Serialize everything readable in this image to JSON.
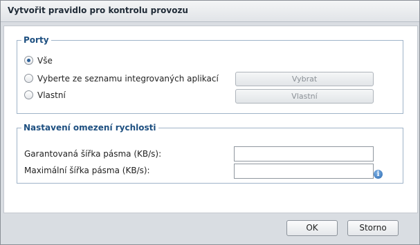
{
  "dialog": {
    "title": "Vytvořit pravidlo pro kontrolu provozu"
  },
  "ports": {
    "legend": "Porty",
    "options": [
      {
        "label": "Vše",
        "checked": true
      },
      {
        "label": "Vyberte ze seznamu integrovaných aplikací",
        "checked": false
      },
      {
        "label": "Vlastní",
        "checked": false
      }
    ],
    "select_button": "Vybrat",
    "custom_button": "Vlastní"
  },
  "speed": {
    "legend": "Nastavení omezení rychlosti",
    "guaranteed_label": "Garantovaná šířka pásma (KB/s):",
    "guaranteed_value": "",
    "max_label": "Maximální šířka pásma (KB/s):",
    "max_value": ""
  },
  "footer": {
    "ok": "OK",
    "cancel": "Storno"
  },
  "icons": {
    "info": "info-icon"
  }
}
